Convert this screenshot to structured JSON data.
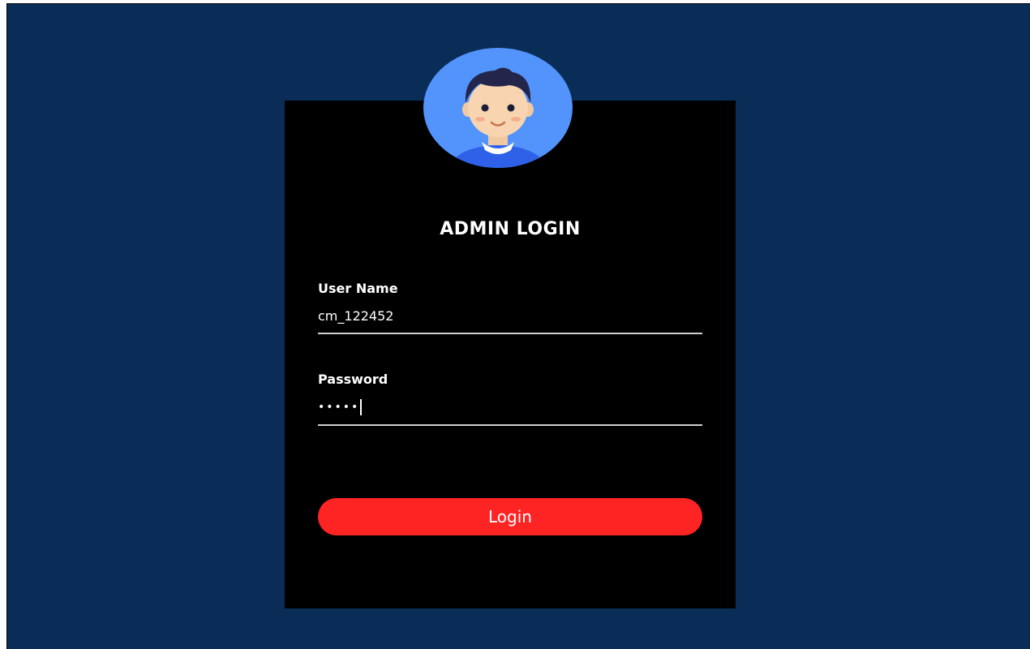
{
  "login": {
    "title": "ADMIN LOGIN",
    "username_label": "User Name",
    "username_value": "cm_122452",
    "password_label": "Password",
    "password_mask": "•••••",
    "button_label": "Login"
  },
  "colors": {
    "background": "#0a2d58",
    "card": "#000000",
    "avatar_bg": "#5294fb",
    "button": "#ff2424"
  },
  "icons": {
    "avatar": "user-avatar-icon"
  }
}
